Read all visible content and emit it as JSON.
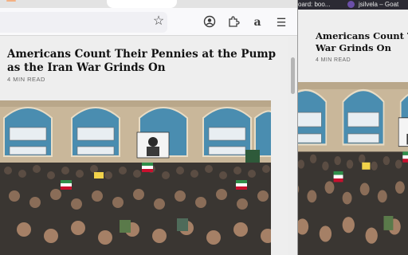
{
  "left_window": {
    "toolbar": {
      "bookmark_icon": "star-icon",
      "account_icon": "account-circle-icon",
      "extensions_icon": "puzzle-icon",
      "amazon_icon": "a",
      "menu_icon": "hamburger-menu-icon"
    },
    "article": {
      "headline": "Americans Count Their Pennies at the Pump as the Iran War Grinds On",
      "read_time": "4 MIN READ"
    }
  },
  "right_window": {
    "tabs": [
      {
        "label": "oard: boo..."
      },
      {
        "label": "jsilvela – Goat"
      }
    ],
    "article": {
      "headline_line1": "Americans Count The",
      "headline_line2": "War Grinds On",
      "read_time": "4 MIN READ"
    }
  },
  "colors": {
    "accent_tab": "#f4b183",
    "headline": "#121212",
    "page_bg": "#eeeeee"
  }
}
